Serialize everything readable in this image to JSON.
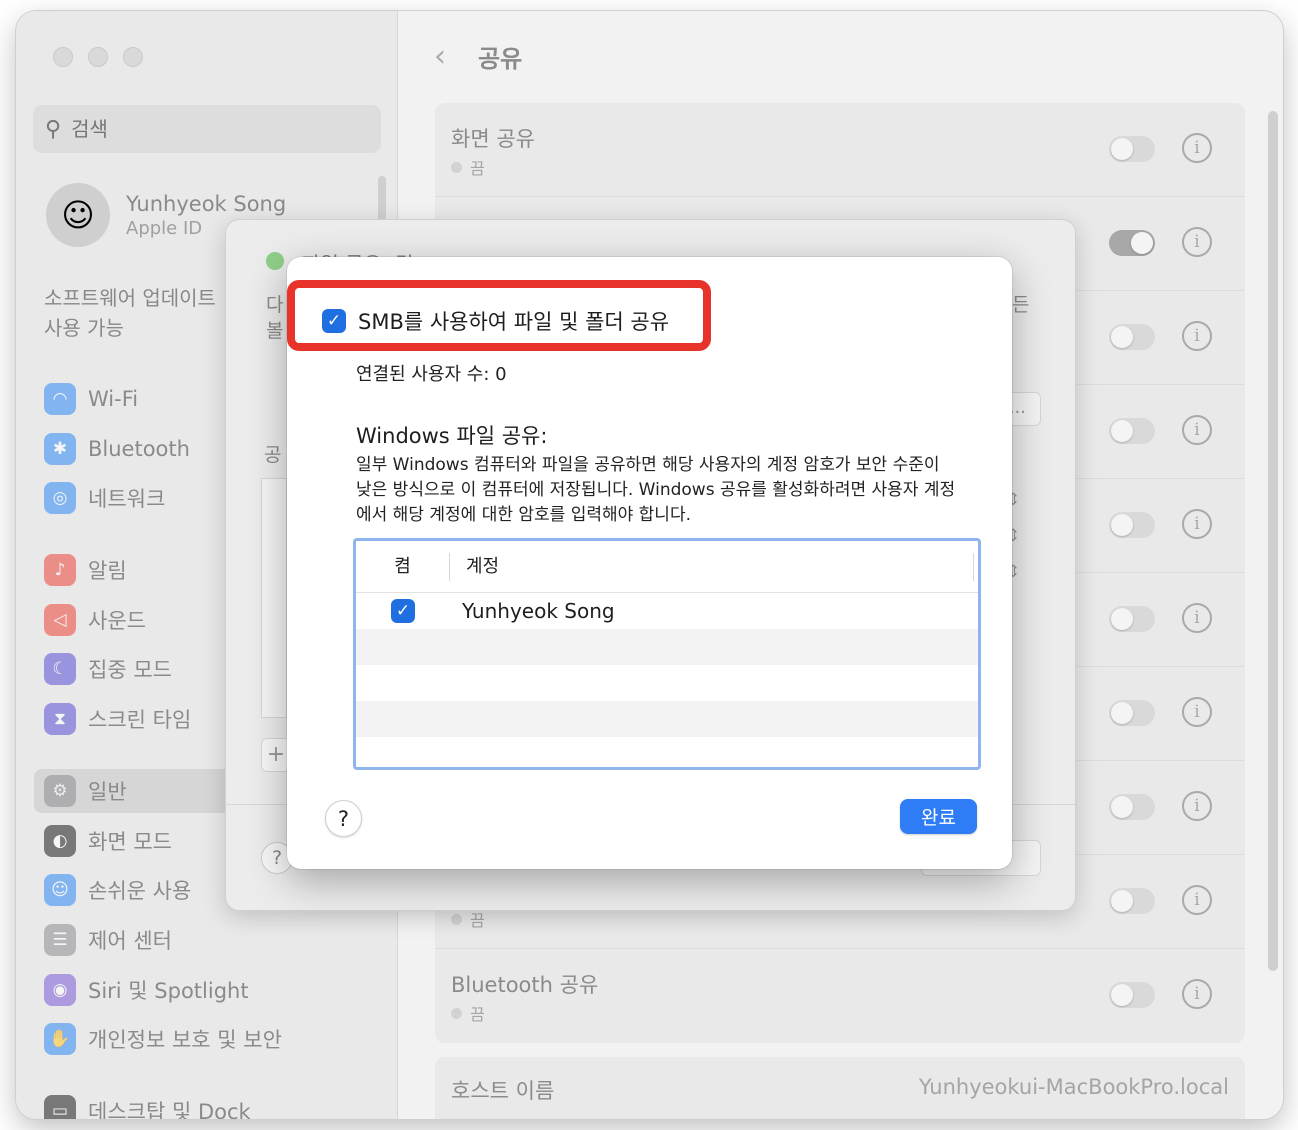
{
  "sidebar": {
    "search_placeholder": "검색",
    "user_name": "Yunhyeok Song",
    "user_sub": "Apple ID",
    "software_update": "소프트웨어 업데이트 사용 가능",
    "items": [
      {
        "label": "Wi-Fi",
        "icon": "wifi-icon",
        "color": "#2f8cf6"
      },
      {
        "label": "Bluetooth",
        "icon": "bluetooth-icon",
        "color": "#2f8cf6"
      },
      {
        "label": "네트워크",
        "icon": "globe-icon",
        "color": "#2f8cf6"
      },
      {
        "label": "알림",
        "icon": "bell-icon",
        "color": "#f0453a"
      },
      {
        "label": "사운드",
        "icon": "speaker-icon",
        "color": "#f0453a"
      },
      {
        "label": "집중 모드",
        "icon": "moon-icon",
        "color": "#5a4fd6"
      },
      {
        "label": "스크린 타임",
        "icon": "hourglass-icon",
        "color": "#5a4fd6"
      },
      {
        "label": "일반",
        "icon": "gear-icon",
        "color": "#8e8e93"
      },
      {
        "label": "화면 모드",
        "icon": "appearance-icon",
        "color": "#1c1c1e"
      },
      {
        "label": "손쉬운 사용",
        "icon": "accessibility-icon",
        "color": "#2f8cf6"
      },
      {
        "label": "제어 센터",
        "icon": "control-center-icon",
        "color": "#8e8e93"
      },
      {
        "label": "Siri 및 Spotlight",
        "icon": "siri-icon",
        "color": "#7b5cd6"
      },
      {
        "label": "개인정보 보호 및 보안",
        "icon": "hand-icon",
        "color": "#2f8cf6"
      },
      {
        "label": "데스크탑 및 Dock",
        "icon": "dock-icon",
        "color": "#1c1c1e"
      }
    ]
  },
  "header": {
    "title": "공유"
  },
  "list": {
    "rows": [
      {
        "title": "화면 공유",
        "status": "끔"
      },
      {
        "title": "",
        "status": ""
      },
      {
        "title": "",
        "status": ""
      },
      {
        "title": "",
        "status": ""
      },
      {
        "title": "",
        "status": ""
      },
      {
        "title": "",
        "status": ""
      },
      {
        "title": "",
        "status": ""
      },
      {
        "title": "",
        "status": ""
      },
      {
        "title": "",
        "status": "끔"
      },
      {
        "title": "Bluetooth 공유",
        "status": "끔"
      }
    ],
    "hostname_label": "호스트 이름",
    "hostname_value": "Yunhyeokui-MacBookPro.local"
  },
  "back_panel": {
    "title": "파일 공유: 켬",
    "frag_left1": "다",
    "frag_left2": "볼",
    "frag_right": "든",
    "frag_share": "공",
    "ellipsis": "...",
    "plus": "+",
    "help": "?"
  },
  "dialog": {
    "smb_label": "SMB를 사용하여 파일 및 폴더 공유",
    "smb_checked": true,
    "connected_users": "연결된 사용자 수: 0",
    "windows_title": "Windows 파일 공유:",
    "windows_desc": "일부 Windows 컴퓨터와 파일을 공유하면 해당 사용자의 계정 암호가 보안 수준이 낮은 방식으로 이 컴퓨터에 저장됩니다. Windows 공유를 활성화하려면 사용자 계정에서 해당 계정에 대한 암호를 입력해야 합니다.",
    "table": {
      "col_on": "켬",
      "col_account": "계정",
      "rows": [
        {
          "checked": true,
          "account": "Yunhyeok Song"
        }
      ]
    },
    "help": "?",
    "done": "완료"
  }
}
